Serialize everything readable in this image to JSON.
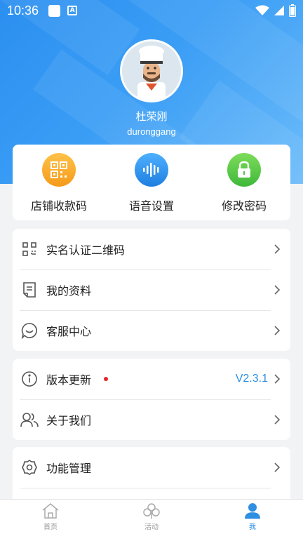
{
  "status_bar": {
    "time": "10:36"
  },
  "profile": {
    "name": "杜荣刚",
    "username": "duronggang"
  },
  "quick_actions": [
    {
      "label": "店铺收款码",
      "icon": "qr-code-icon",
      "color": "#f6a623"
    },
    {
      "label": "语音设置",
      "icon": "voice-wave-icon",
      "color": "#2f8fe0"
    },
    {
      "label": "修改密码",
      "icon": "lock-icon",
      "color": "#4dc24a"
    }
  ],
  "menu_group1": [
    {
      "label": "实名认证二维码",
      "icon": "qr-scan-icon"
    },
    {
      "label": "我的资料",
      "icon": "document-edit-icon"
    },
    {
      "label": "客服中心",
      "icon": "chat-smile-icon"
    }
  ],
  "menu_group2": [
    {
      "label": "版本更新",
      "icon": "info-icon",
      "value": "V2.3.1",
      "badge": "red-dot"
    },
    {
      "label": "关于我们",
      "icon": "users-icon"
    }
  ],
  "menu_group3": [
    {
      "label": "功能管理",
      "icon": "settings-gear-icon"
    }
  ],
  "tab_bar": [
    {
      "label": "首页",
      "icon": "home-icon",
      "active": false
    },
    {
      "label": "活动",
      "icon": "clover-icon",
      "active": false
    },
    {
      "label": "我",
      "icon": "person-icon",
      "active": true
    }
  ],
  "colors": {
    "accent": "#2f8fe0",
    "hero_top": "#2b8ff0",
    "badge": "#e5242b"
  }
}
